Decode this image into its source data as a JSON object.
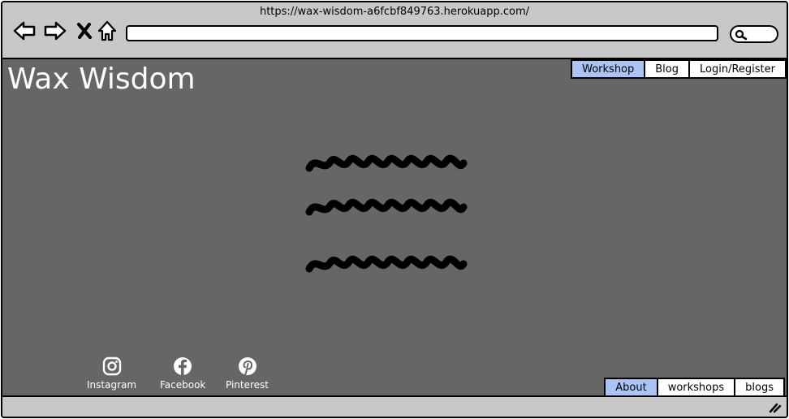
{
  "browser": {
    "url": "https://wax-wisdom-a6fcbf849763.herokuapp.com/",
    "icons": [
      "back-icon",
      "forward-icon",
      "close-icon",
      "home-icon",
      "search-icon"
    ]
  },
  "site": {
    "title": "Wax Wisdom"
  },
  "top_nav": {
    "items": [
      {
        "label": "Workshop",
        "active": true
      },
      {
        "label": "Blog",
        "active": false
      },
      {
        "label": "Login/Register",
        "active": false
      }
    ]
  },
  "social": {
    "items": [
      {
        "label": "Instagram",
        "icon": "instagram-icon"
      },
      {
        "label": "Facebook",
        "icon": "facebook-icon"
      },
      {
        "label": "Pinterest",
        "icon": "pinterest-icon"
      }
    ]
  },
  "footer_nav": {
    "items": [
      {
        "label": "About",
        "active": true
      },
      {
        "label": "workshops",
        "active": false
      },
      {
        "label": "blogs",
        "active": false
      }
    ]
  },
  "colors": {
    "viewport_bg": "#666666",
    "chrome_bg": "#c8c8c8",
    "active_tab": "#a9c4f5"
  }
}
